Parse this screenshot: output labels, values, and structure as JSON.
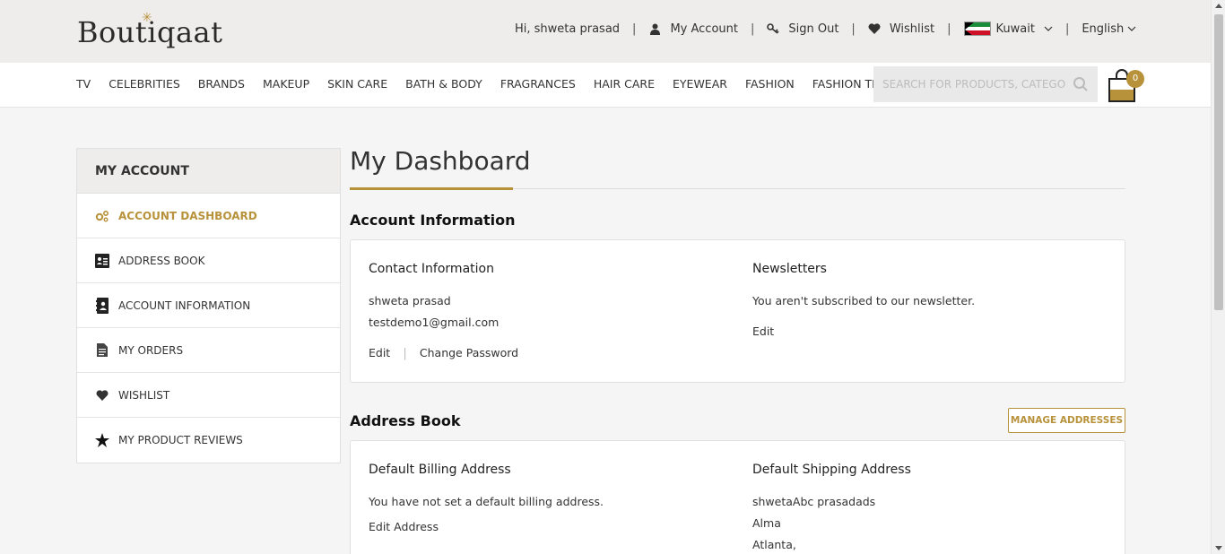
{
  "header": {
    "logo_text": "Boutiqaat",
    "greeting": "Hi, shweta prasad",
    "my_account": "My Account",
    "sign_out": "Sign Out",
    "wishlist": "Wishlist",
    "country": "Kuwait",
    "language": "English",
    "separator": "|"
  },
  "nav": {
    "items": [
      "TV",
      "CELEBRITIES",
      "BRANDS",
      "MAKEUP",
      "SKIN CARE",
      "BATH & BODY",
      "FRAGRANCES",
      "HAIR CARE",
      "EYEWEAR",
      "FASHION",
      "FASHION TECH"
    ],
    "search_placeholder": "SEARCH FOR PRODUCTS, CATEGORIES",
    "cart_count": "0"
  },
  "sidebar": {
    "title": "MY ACCOUNT",
    "items": [
      {
        "label": "ACCOUNT DASHBOARD",
        "icon": "gears-icon"
      },
      {
        "label": "ADDRESS BOOK",
        "icon": "address-card-icon"
      },
      {
        "label": "ACCOUNT INFORMATION",
        "icon": "contact-book-icon"
      },
      {
        "label": "MY ORDERS",
        "icon": "document-icon"
      },
      {
        "label": "WISHLIST",
        "icon": "heart-icon"
      },
      {
        "label": "MY PRODUCT REVIEWS",
        "icon": "star-icon"
      }
    ]
  },
  "main": {
    "page_title": "My Dashboard",
    "account_info": {
      "title": "Account Information",
      "contact": {
        "heading": "Contact Information",
        "name": "shweta prasad",
        "email": "testdemo1@gmail.com",
        "edit": "Edit",
        "change_password": "Change Password"
      },
      "newsletters": {
        "heading": "Newsletters",
        "text": "You aren't subscribed to our newsletter.",
        "edit": "Edit"
      }
    },
    "address_book": {
      "title": "Address Book",
      "manage": "MANAGE ADDRESSES",
      "billing": {
        "heading": "Default Billing Address",
        "text": "You have not set a default billing address.",
        "edit": "Edit Address"
      },
      "shipping": {
        "heading": "Default Shipping Address",
        "line1": "shwetaAbc prasadads",
        "line2": "Alma",
        "line3": "Atlanta,"
      }
    }
  },
  "colors": {
    "accent": "#b8923b",
    "topbar": "#efedec"
  }
}
